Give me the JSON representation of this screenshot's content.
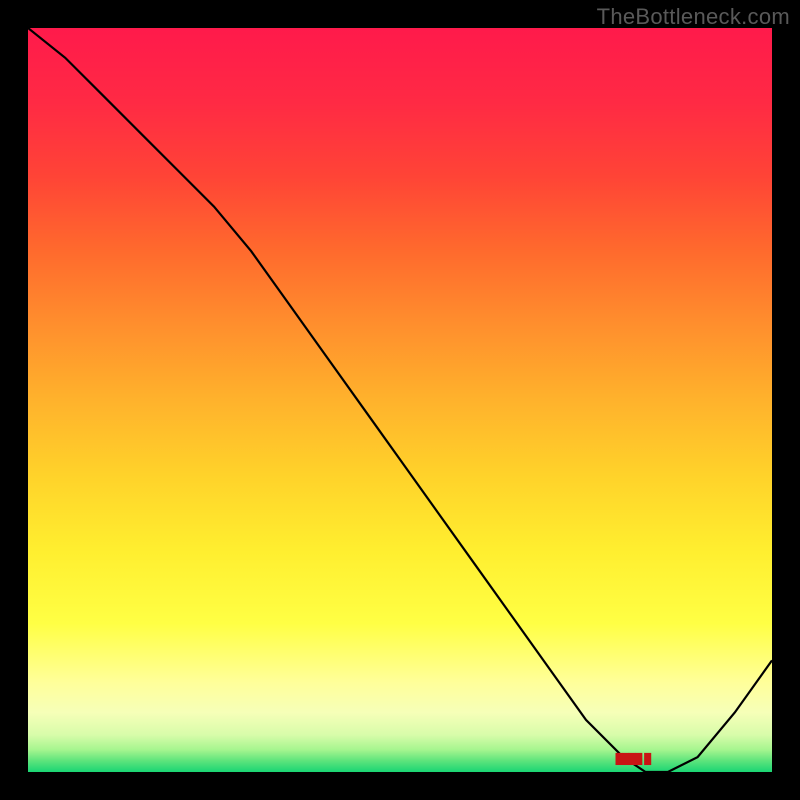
{
  "attribution": "TheBottleneck.com",
  "chart_data": {
    "type": "line",
    "title": "",
    "xlabel": "",
    "ylabel": "",
    "xlim": [
      0,
      100
    ],
    "ylim": [
      0,
      100
    ],
    "x": [
      0,
      5,
      10,
      15,
      20,
      25,
      30,
      35,
      40,
      45,
      50,
      55,
      60,
      65,
      70,
      75,
      80,
      83,
      86,
      90,
      95,
      100
    ],
    "values": [
      100,
      96,
      91,
      86,
      81,
      76,
      70,
      63,
      56,
      49,
      42,
      35,
      28,
      21,
      14,
      7,
      2,
      0,
      0,
      2,
      8,
      15
    ],
    "background_gradient": {
      "stops": [
        {
          "offset": 0.0,
          "color": "#ff1a4b"
        },
        {
          "offset": 0.1,
          "color": "#ff2a44"
        },
        {
          "offset": 0.2,
          "color": "#ff4436"
        },
        {
          "offset": 0.3,
          "color": "#ff6a2d"
        },
        {
          "offset": 0.4,
          "color": "#ff8f2d"
        },
        {
          "offset": 0.5,
          "color": "#ffb22c"
        },
        {
          "offset": 0.6,
          "color": "#ffd22a"
        },
        {
          "offset": 0.7,
          "color": "#ffee2f"
        },
        {
          "offset": 0.8,
          "color": "#ffff44"
        },
        {
          "offset": 0.88,
          "color": "#ffff9a"
        },
        {
          "offset": 0.92,
          "color": "#f6ffb8"
        },
        {
          "offset": 0.95,
          "color": "#d8fcaa"
        },
        {
          "offset": 0.97,
          "color": "#a6f58f"
        },
        {
          "offset": 0.985,
          "color": "#5de47c"
        },
        {
          "offset": 1.0,
          "color": "#1ad574"
        }
      ]
    },
    "annotations": [
      {
        "x": 83,
        "y": 1.5,
        "text": "████ █"
      }
    ]
  }
}
